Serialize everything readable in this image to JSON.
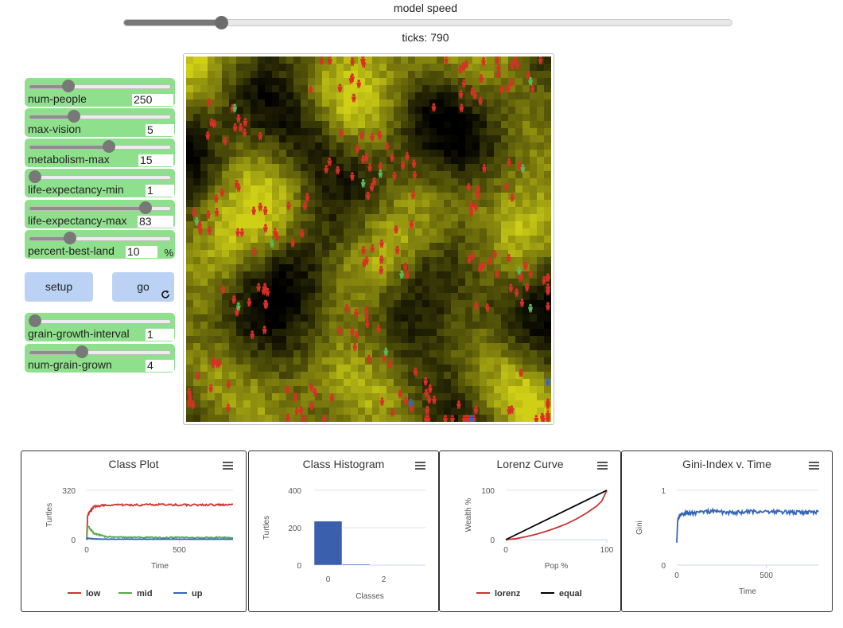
{
  "speed": {
    "label": "model speed",
    "value_fraction": 0.16
  },
  "ticks": {
    "text": "ticks: 790"
  },
  "sliders": [
    {
      "name": "num-people",
      "value": "250",
      "unit": "",
      "fraction": 0.26
    },
    {
      "name": "max-vision",
      "value": "5",
      "unit": "",
      "fraction": 0.3
    },
    {
      "name": "metabolism-max",
      "value": "15",
      "unit": "",
      "fraction": 0.57
    },
    {
      "name": "life-expectancy-min",
      "value": "1",
      "unit": "",
      "fraction": 0.0
    },
    {
      "name": "life-expectancy-max",
      "value": "83",
      "unit": "",
      "fraction": 0.85
    },
    {
      "name": "percent-best-land",
      "value": "10",
      "unit": "%",
      "fraction": 0.27
    },
    {
      "name": "grain-growth-interval",
      "value": "1",
      "unit": "",
      "fraction": 0.0
    },
    {
      "name": "num-grain-grown",
      "value": "4",
      "unit": "",
      "fraction": 0.36
    }
  ],
  "buttons": {
    "setup": "setup",
    "go": "go"
  },
  "world": {
    "colors": {
      "grain_high": "#e6e64a",
      "grain_low": "#000000",
      "poor": "#d73027",
      "middle": "#5cb85c",
      "rich": "#3366cc"
    },
    "people_counts": {
      "poor": 230,
      "middle": 12,
      "rich": 3
    }
  },
  "plots": {
    "class_plot": {
      "title": "Class Plot",
      "xlabel": "Time",
      "ylabel": "Turtles",
      "yticks": [
        "320",
        "0"
      ],
      "xticks": [
        "0",
        "500"
      ],
      "legend": [
        {
          "label": "low",
          "color": "#cc3333"
        },
        {
          "label": "mid",
          "color": "#55aa44"
        },
        {
          "label": "up",
          "color": "#3366bb"
        }
      ]
    },
    "class_histogram": {
      "title": "Class Histogram",
      "xlabel": "Classes",
      "ylabel": "Turtles",
      "yticks": [
        "400",
        "200",
        "0"
      ],
      "xticks": [
        "0",
        "2"
      ],
      "bars": [
        235,
        5,
        0
      ],
      "bar_color": "#3a5fad"
    },
    "lorenz_curve": {
      "title": "Lorenz Curve",
      "xlabel": "Pop %",
      "ylabel": "Wealth %",
      "yticks": [
        "100",
        "0"
      ],
      "xticks": [
        "0",
        "100"
      ],
      "legend": [
        {
          "label": "lorenz",
          "color": "#cc3333"
        },
        {
          "label": "equal",
          "color": "#000000"
        }
      ]
    },
    "gini_index": {
      "title": "Gini-Index v. Time",
      "xlabel": "Time",
      "ylabel": "Gini",
      "yticks": [
        "1",
        "0"
      ],
      "xticks": [
        "0",
        "500"
      ],
      "line_color": "#3366bb"
    }
  },
  "chart_data": [
    {
      "type": "line",
      "title": "Class Plot",
      "xlabel": "Time",
      "ylabel": "Turtles",
      "xlim": [
        0,
        790
      ],
      "ylim": [
        0,
        320
      ],
      "series": [
        {
          "name": "low",
          "x": [
            0,
            5,
            40,
            100,
            200,
            300,
            400,
            500,
            600,
            700,
            790
          ],
          "values": [
            0,
            160,
            215,
            225,
            225,
            225,
            228,
            225,
            225,
            225,
            230
          ]
        },
        {
          "name": "mid",
          "x": [
            0,
            5,
            40,
            100,
            200,
            300,
            400,
            500,
            600,
            700,
            790
          ],
          "values": [
            0,
            90,
            40,
            20,
            15,
            15,
            12,
            15,
            12,
            15,
            12
          ]
        },
        {
          "name": "up",
          "x": [
            0,
            5,
            40,
            100,
            200,
            300,
            400,
            500,
            600,
            700,
            790
          ],
          "values": [
            0,
            10,
            5,
            3,
            3,
            3,
            3,
            3,
            3,
            3,
            3
          ]
        }
      ]
    },
    {
      "type": "bar",
      "title": "Class Histogram",
      "xlabel": "Classes",
      "ylabel": "Turtles",
      "categories": [
        "0",
        "1",
        "2"
      ],
      "values": [
        235,
        5,
        0
      ],
      "ylim": [
        0,
        400
      ]
    },
    {
      "type": "line",
      "title": "Lorenz Curve",
      "xlabel": "Pop %",
      "ylabel": "Wealth %",
      "xlim": [
        0,
        100
      ],
      "ylim": [
        0,
        100
      ],
      "series": [
        {
          "name": "lorenz",
          "x": [
            0,
            10,
            20,
            30,
            40,
            50,
            60,
            70,
            80,
            90,
            95,
            100
          ],
          "values": [
            0,
            2,
            6,
            11,
            17,
            24,
            32,
            42,
            54,
            68,
            78,
            100
          ]
        },
        {
          "name": "equal",
          "x": [
            0,
            100
          ],
          "values": [
            0,
            100
          ]
        }
      ]
    },
    {
      "type": "line",
      "title": "Gini-Index v. Time",
      "xlabel": "Time",
      "ylabel": "Gini",
      "xlim": [
        0,
        790
      ],
      "ylim": [
        0,
        1
      ],
      "series": [
        {
          "name": "gini",
          "x": [
            0,
            5,
            20,
            50,
            100,
            200,
            300,
            400,
            500,
            600,
            700,
            790
          ],
          "values": [
            0.3,
            0.6,
            0.68,
            0.69,
            0.7,
            0.72,
            0.7,
            0.71,
            0.72,
            0.71,
            0.7,
            0.71
          ]
        }
      ]
    }
  ]
}
